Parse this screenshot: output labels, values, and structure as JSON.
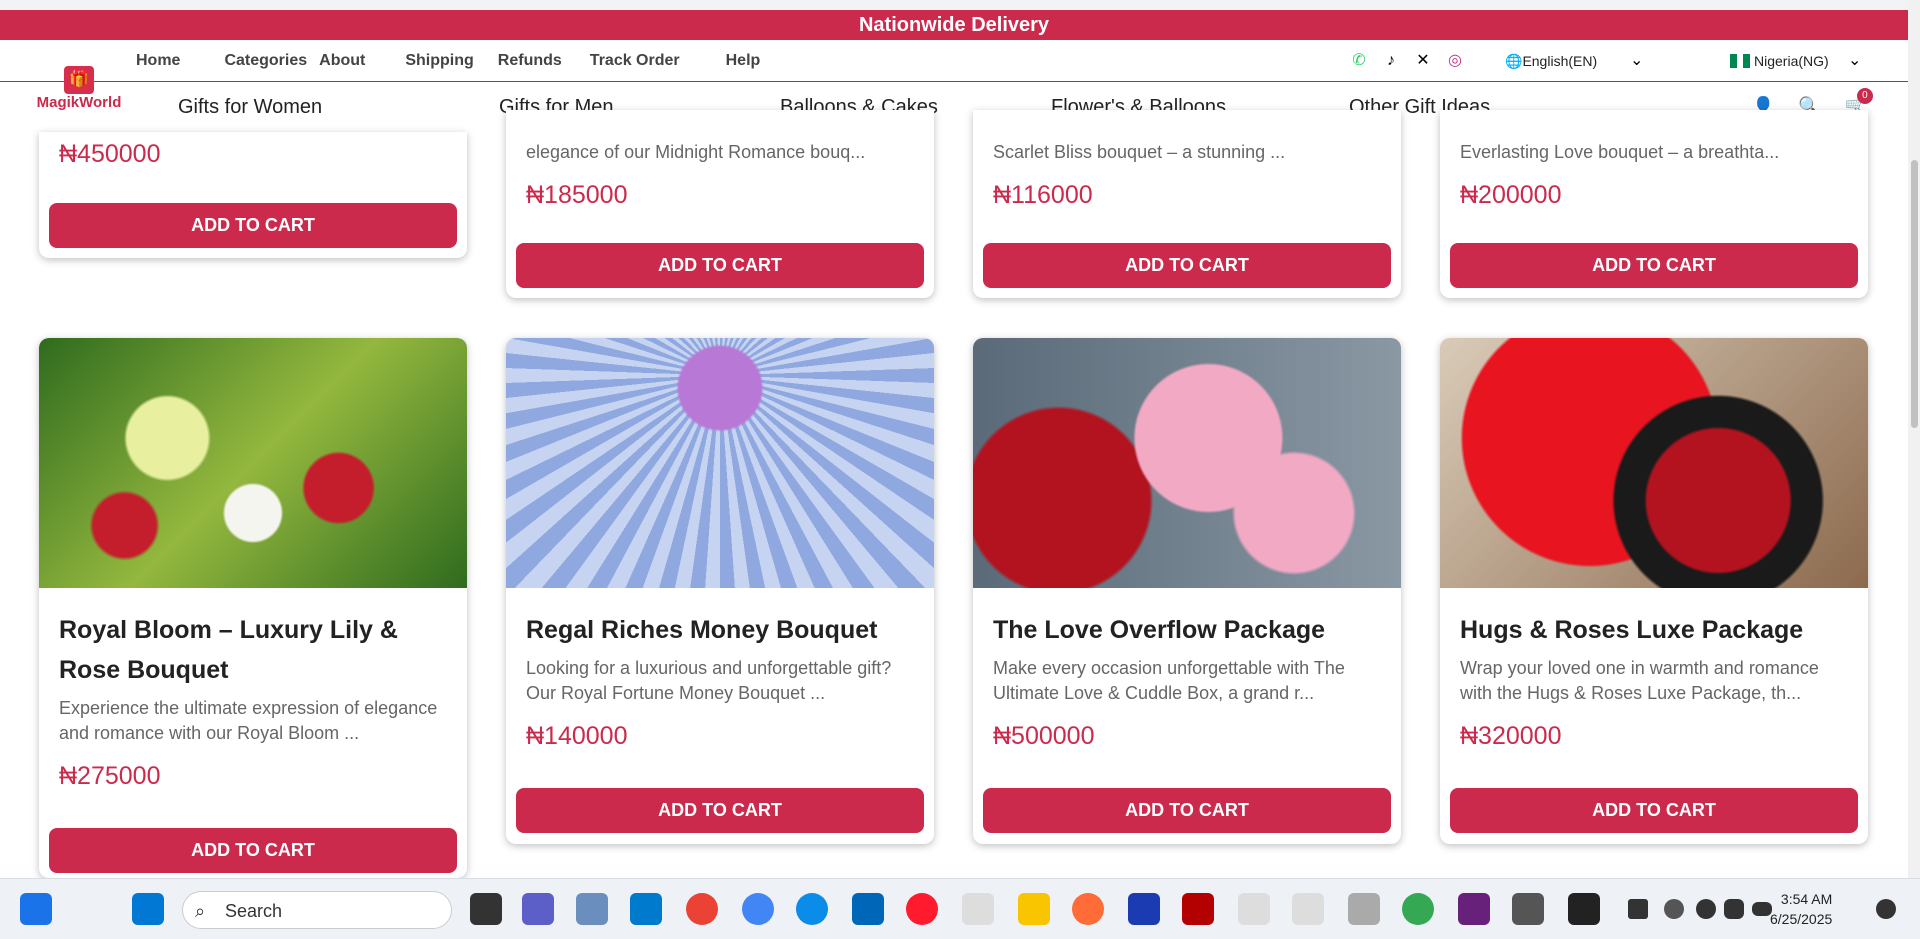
{
  "banner": {
    "text": "Nationwide Delivery"
  },
  "nav": {
    "links": [
      "Home",
      "Categories",
      "About",
      "Shipping",
      "Refunds",
      "Track Order",
      "Help"
    ]
  },
  "language": {
    "label": "English(EN)"
  },
  "country": {
    "label": "Nigeria(NG)"
  },
  "logo": {
    "text": "MagikWorld"
  },
  "categories": [
    "Gifts for Women",
    "Gifts for Men",
    "Balloons & Cakes",
    "Flower's & Balloons",
    "Other Gift Ideas"
  ],
  "cart": {
    "count": "0"
  },
  "top_cards": [
    {
      "desc": "",
      "price": "₦450000",
      "button": "ADD TO CART"
    },
    {
      "desc": "elegance of our Midnight Romance bouq...",
      "price": "₦185000",
      "button": "ADD TO CART"
    },
    {
      "desc": "Scarlet Bliss bouquet – a stunning ...",
      "price": "₦116000",
      "button": "ADD TO CART"
    },
    {
      "desc": "Everlasting Love bouquet – a breathta...",
      "price": "₦200000",
      "button": "ADD TO CART"
    }
  ],
  "cards": [
    {
      "title": "Royal Bloom – Luxury Lily & Rose Bouquet",
      "desc": "Experience the ultimate expression of elegance and romance with our Royal Bloom ...",
      "price": "₦275000",
      "button": "ADD TO CART",
      "colors": [
        "#2f6b1e",
        "#c41d2b"
      ]
    },
    {
      "title": "Regal Riches Money Bouquet",
      "desc": "Looking for a luxurious and unforgettable gift? Our Royal Fortune Money Bouquet ...",
      "price": "₦140000",
      "button": "ADD TO CART",
      "colors": [
        "#8fa8df",
        "#b879d6"
      ]
    },
    {
      "title": "The Love Overflow Package",
      "desc": "Make every occasion unforgettable with The Ultimate Love & Cuddle Box, a grand r...",
      "price": "₦500000",
      "button": "ADD TO CART",
      "colors": [
        "#f2a9c4",
        "#b3121f"
      ]
    },
    {
      "title": "Hugs & Roses Luxe Package",
      "desc": "Wrap your loved one in warmth and romance with the Hugs & Roses Luxe Package, th...",
      "price": "₦320000",
      "button": "ADD TO CART",
      "colors": [
        "#e8141f",
        "#1a1a1a"
      ]
    }
  ],
  "taskbar": {
    "search": "Search",
    "time": "3:54 AM",
    "date": "6/25/2025"
  },
  "colors": {
    "brand": "#cb2a4c"
  }
}
